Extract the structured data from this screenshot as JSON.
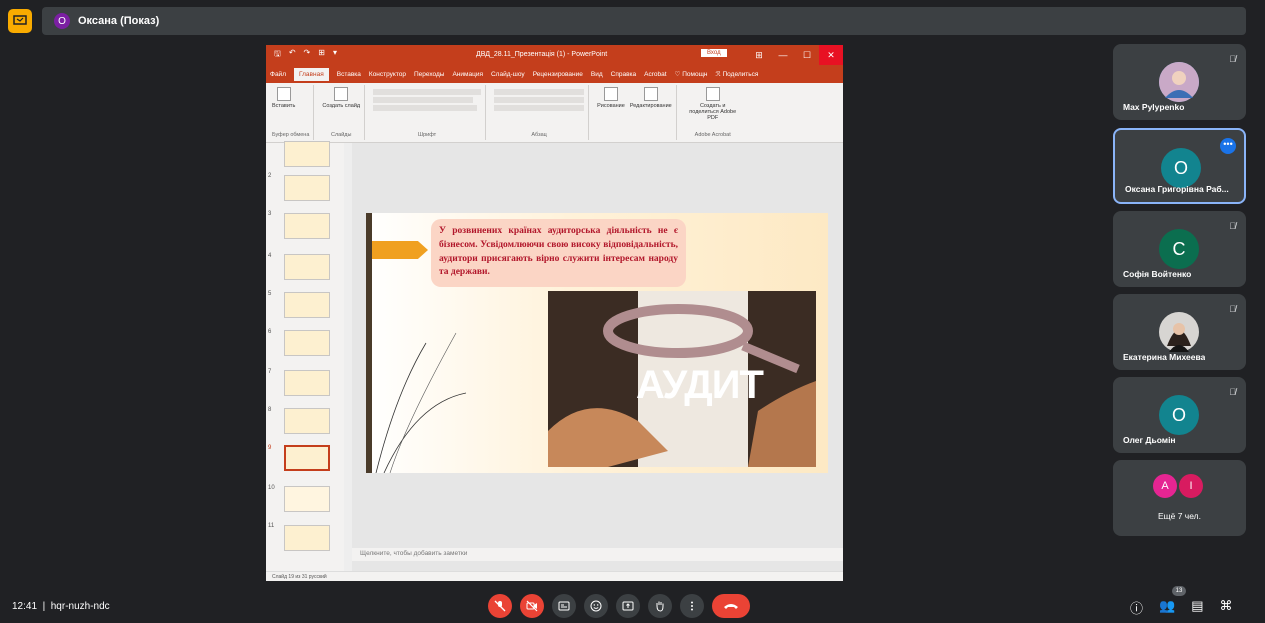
{
  "presenter": {
    "initial": "О",
    "label": "Оксана (Показ)"
  },
  "ppt": {
    "quick_access": [
      "🖫",
      "↶",
      "↷",
      "⊞",
      "▾"
    ],
    "title": "ДВД_28.11_Презентація (1) - PowerPoint",
    "login": "Вход",
    "window_controls": [
      "⊞",
      "—",
      "☐",
      "✕"
    ],
    "tabs": [
      "Файл",
      "Главная",
      "Вставка",
      "Конструктор",
      "Переходы",
      "Анимация",
      "Слайд-шоу",
      "Рецензирование",
      "Вид",
      "Справка",
      "Acrobat",
      "♡ Помощн",
      "ℛ Поделиться"
    ],
    "active_tab": "Главная",
    "ribbon": {
      "groups": [
        {
          "name": "Буфер обмена",
          "buttons": [
            "Вставить"
          ]
        },
        {
          "name": "Слайды",
          "buttons": [
            "Создать слайд"
          ]
        },
        {
          "name": "Шрифт",
          "buttons": []
        },
        {
          "name": "Абзац",
          "buttons": []
        },
        {
          "name": "",
          "buttons": [
            "Рисование",
            "Редактирование"
          ]
        },
        {
          "name": "Adobe Acrobat",
          "buttons": [
            "Создать и поделиться Adobe PDF"
          ]
        }
      ]
    },
    "thumbnail_numbers": [
      "2",
      "3",
      "4",
      "5",
      "6",
      "7",
      "8",
      "9",
      "10",
      "11"
    ],
    "slide": {
      "callout": "У розвинених країнах аудиторська діяльність не є бізнесом. Усвідомлюючи свою високу відповідальність, аудитори присягають вірно служити інтересам народу та держави.",
      "image_text": "АУДИТ"
    },
    "notes_placeholder": "Щелкните, чтобы добавить заметки",
    "status": "Слайд 19 из 31   русский"
  },
  "participants": [
    {
      "name": "Max Pylypenko",
      "initial": "",
      "color": "#8ab4f8",
      "muted": true,
      "has_photo": true
    },
    {
      "name": "Оксана Григорівна Раб...",
      "initial": "О",
      "color": "#12848f",
      "muted": false,
      "active": true
    },
    {
      "name": "Софія Войтенко",
      "initial": "С",
      "color": "#0b6e4f",
      "muted": true
    },
    {
      "name": "Екатерина Михеева",
      "initial": "",
      "color": "#5f6368",
      "muted": true,
      "has_photo": true
    },
    {
      "name": "Олег Дьомін",
      "initial": "О",
      "color": "#12848f",
      "muted": true
    }
  ],
  "more": {
    "initials": [
      "А",
      "І"
    ],
    "colors": [
      "#e52592",
      "#d81b60"
    ],
    "label": "Ещё 7 чел."
  },
  "bottom": {
    "time": "12:41",
    "meeting_code": "hqr-nuzh-ndc",
    "people_count": "13",
    "controls": [
      "mic-off",
      "cam-off",
      "captions",
      "emoji",
      "present",
      "raise-hand",
      "more",
      "end-call"
    ]
  }
}
